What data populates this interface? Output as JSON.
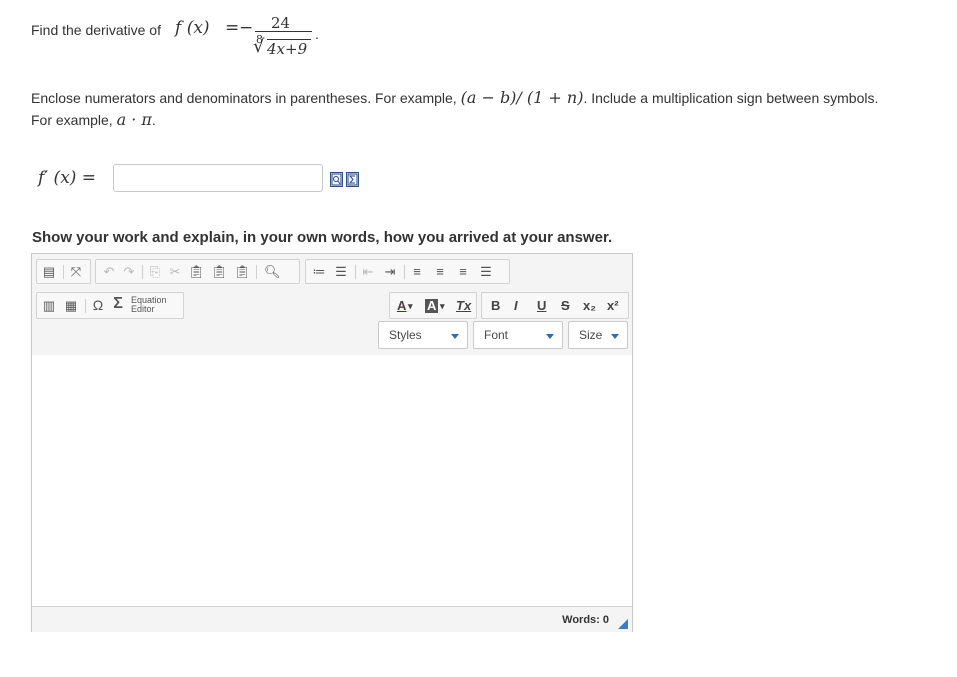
{
  "question": {
    "prompt": "Find the derivative of",
    "function_lhs": "f (x)",
    "equals": "=",
    "negative_sign": "−",
    "numerator": "24",
    "root_index": "8",
    "radicand": "4x+9",
    "end_period": "."
  },
  "instructions": {
    "part1": "Enclose numerators and denominators in parentheses. For example,",
    "example1": "(a − b)/ (1 + n)",
    "part2": ". Include a multiplication sign between symbols. For example,",
    "example2": "a · π",
    "part3": "."
  },
  "answer": {
    "label": "f′ (x) =",
    "value": "",
    "placeholder": ""
  },
  "work": {
    "prompt": "Show your work and explain, in your own words, how you arrived at your answer."
  },
  "editor": {
    "equation_editor_label_line1": "Equation",
    "equation_editor_label_line2": "Editor",
    "styles_label": "Styles",
    "font_label": "Font",
    "size_label": "Size",
    "word_count": "Words: 0",
    "format_buttons": {
      "bold": "B",
      "italic": "I",
      "underline": "U",
      "strikethrough": "S",
      "subscript": "x₂",
      "superscript": "x²",
      "text_color": "A",
      "bg_color": "A",
      "remove_format": "Tx",
      "omega": "Ω",
      "sigma": "Σ"
    },
    "accent_color": "#2a6fb3"
  }
}
